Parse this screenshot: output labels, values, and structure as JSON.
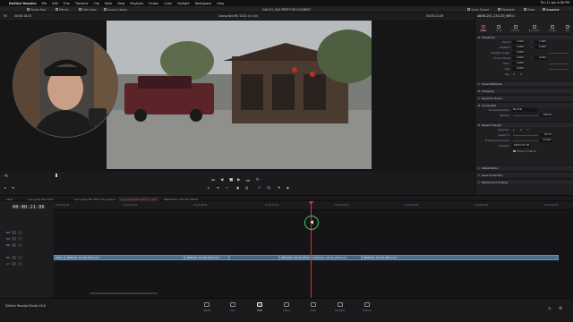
{
  "menubar": {
    "apple": "",
    "app_name": "DaVinci Resolve",
    "items": [
      "File",
      "Edit",
      "Trim",
      "Timeline",
      "Clip",
      "Mark",
      "View",
      "Playback",
      "Fusion",
      "Color",
      "Fairlight",
      "Workspace",
      "Help"
    ],
    "clock": "Thu 11 Jan 6:38 PM"
  },
  "toolbar": {
    "media_pool": "Media Pool",
    "effects": "Effects",
    "edit_index": "Edit Index",
    "sound_library": "Sound Library",
    "project_title": "240111_FILE PREP FOR COLORIST",
    "quick_export": "Quick Export",
    "metadata": "Metadata",
    "mixer": "Mixer",
    "inspector": "Inspector"
  },
  "viewer": {
    "zoom": "Fit",
    "source_timecode": "00:00:18:15",
    "clip_title": "Leong Kee MV 2024 (in 1hr)",
    "record_timecode": "00:00:21:06"
  },
  "inspector": {
    "clip_name": "AB06C201_231130_WPCO",
    "tabs": [
      {
        "label": "Video",
        "icon": "video-icon",
        "active": true
      },
      {
        "label": "Audio",
        "icon": "audio-icon",
        "active": false
      },
      {
        "label": "Effects",
        "icon": "effects-icon",
        "active": false
      },
      {
        "label": "Transition",
        "icon": "transition-icon",
        "active": false
      },
      {
        "label": "Image",
        "icon": "image-icon",
        "active": false
      },
      {
        "label": "File",
        "icon": "file-icon",
        "active": false
      }
    ],
    "transform": {
      "title": "Transform",
      "zoom_label": "Zoom",
      "zoom_x": "1.000",
      "zoom_y": "1.000",
      "position_label": "Position",
      "position_x": "0.000",
      "position_y": "0.000",
      "rotation_label": "Rotation Angle",
      "rotation": "0.000",
      "anchor_label": "Anchor Point",
      "anchor_x": "0.000",
      "anchor_y": "0.000",
      "pitch_label": "Pitch",
      "pitch": "0.000",
      "yaw_label": "Yaw",
      "yaw": "0.000",
      "flip_label": "Flip"
    },
    "smart_reframe": "Smart Reframe",
    "cropping": "Cropping",
    "dynamic_zoom": "Dynamic Zoom",
    "composite": {
      "title": "Composite",
      "mode_label": "Composite Mode",
      "mode_value": "Normal",
      "opacity_label": "Opacity",
      "opacity_value": "100.00"
    },
    "speed_change": {
      "title": "Speed Change",
      "direction_label": "Direction",
      "speed_label": "Speed %",
      "speed_value": "94.70",
      "fps_label": "Frames per Second",
      "fps_value": "23.697",
      "duration_label": "Duration",
      "duration_value": "00:00:07:16",
      "ripple_label": "Ripple Timeline"
    },
    "stabilization": "Stabilization",
    "lens_correction": "Lens Correction",
    "retime_scaling": "Retime and Scaling"
  },
  "transport": {
    "buttons": [
      "skip-back",
      "step-back",
      "stop",
      "play",
      "step-forward",
      "loop"
    ]
  },
  "timeline_tabs": [
    {
      "label": "Start",
      "active": false
    },
    {
      "label": "Leong Kee MV 2024",
      "active": false
    },
    {
      "label": "Leong Kee MV 2024 (for grader)",
      "active": false
    },
    {
      "label": "Leong Kee MV 2024 (in 1hr)",
      "active": true
    },
    {
      "label": "AB06C201_231130_WPCO",
      "active": false
    }
  ],
  "timeline": {
    "timecode": "00:00:21:06",
    "tracks": [
      "V4",
      "V3",
      "V2",
      "V1",
      "A1"
    ],
    "ruler": [
      "01:00:00:00",
      "01:00:04:00",
      "01:00:08:00",
      "01:00:12:00",
      "01:00:16:00",
      "01:00:20:00",
      "01:00:24:00",
      "01:00:28:00",
      "01:00:32:00",
      "01:00:36:00"
    ],
    "clips": [
      {
        "label": "AB06C..."
      },
      {
        "label": "AB06C201_231130_WPCO.mxf"
      },
      {
        "label": "AB06C201_231130_WPCO.mxf"
      },
      {
        "label": "AB06C201_231130_WPCO.mxf"
      },
      {
        "label": "AB06C201_231130_WPCO.mxf"
      },
      {
        "label": "AB06C201_231130_WPCO.mxf"
      }
    ]
  },
  "app_footer": "DaVinci Resolve Studio 18.6",
  "pages": [
    {
      "label": "Media",
      "active": false
    },
    {
      "label": "Cut",
      "active": false
    },
    {
      "label": "Edit",
      "active": true
    },
    {
      "label": "Fusion",
      "active": false
    },
    {
      "label": "Color",
      "active": false
    },
    {
      "label": "Fairlight",
      "active": false
    },
    {
      "label": "Deliver",
      "active": false
    }
  ],
  "colors": {
    "accent": "#e5531a",
    "playhead": "#e02f2f",
    "clip": "#4d6f8e",
    "cursor_ring": "#45c46b"
  }
}
